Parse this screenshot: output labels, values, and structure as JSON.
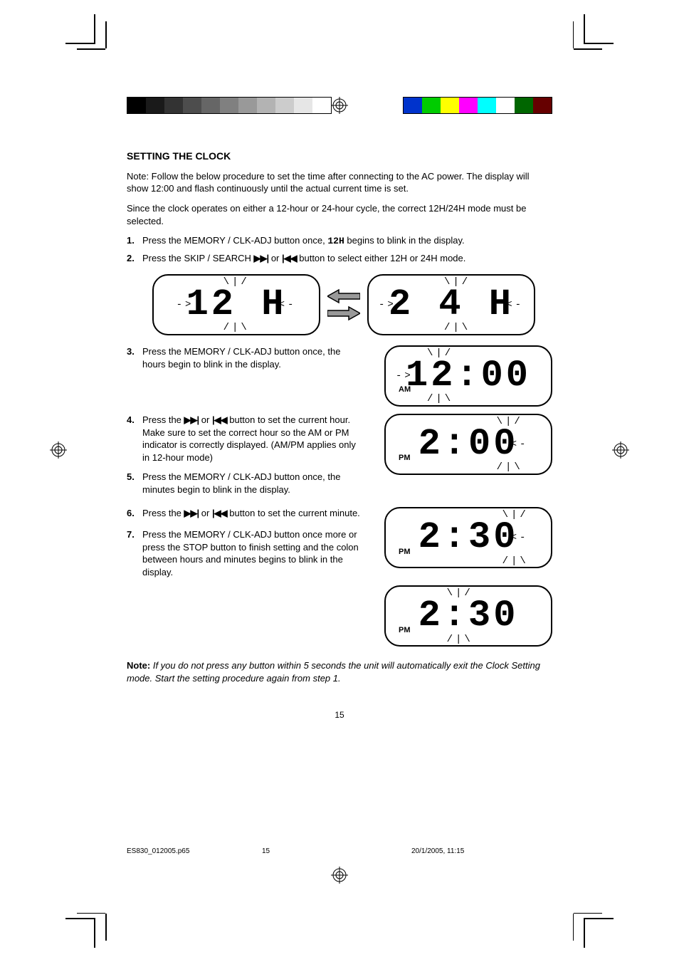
{
  "header": {
    "gray_shades": [
      "#000000",
      "#1a1a1a",
      "#333333",
      "#4d4d4d",
      "#666666",
      "#808080",
      "#999999",
      "#b3b3b3",
      "#cccccc",
      "#e6e6e6",
      "#ffffff"
    ],
    "color_swatches": [
      "#0033cc",
      "#00cc00",
      "#ffff00",
      "#ff00ff",
      "#00ffff",
      "#ffffff",
      "#006600",
      "#660000"
    ]
  },
  "section_title": "SETTING THE CLOCK",
  "intro_1": "Note: Follow the below procedure to set the time after connecting to the AC power. The display will show 12:00 and flash continuously until the actual current time is set.",
  "intro_2": "Since the clock operates on either a 12-hour or 24-hour cycle, the correct 12H/24H mode must be selected.",
  "steps": {
    "s1_a": "Press the MEMORY / CLK-ADJ button once, ",
    "s1_b": " begins to blink in the display.",
    "s1_lcd": "12H",
    "s2_a": "Press the SKIP / SEARCH ",
    "s2_b": " or ",
    "s2_c": " button to select either 12H or 24H mode.",
    "lcd_12h": "12 H",
    "lcd_24h": "2 4 H",
    "s3": "Press the MEMORY / CLK-ADJ button once, the hours begin to blink in the display.",
    "lcd_1200": "12:00",
    "lcd_1200_ampm": "AM",
    "s4_a": "Press the ",
    "s4_b": " or ",
    "s4_c": " button to set the current hour. Make sure to set the correct hour so the AM or PM indicator is correctly displayed. (AM/PM applies only in 12-hour mode)",
    "lcd_200": "2:00",
    "lcd_200_ampm": "PM",
    "s5": "Press the MEMORY / CLK-ADJ button once, the minutes begin to blink in the display.",
    "s6_a": "Press the ",
    "s6_b": " or ",
    "s6_c": " button to set the current minute.",
    "lcd_230a": "2:30",
    "lcd_230a_ampm": "PM",
    "s7": "Press the MEMORY / CLK-ADJ button once more or press the STOP button to finish setting and the colon between hours and minutes begins to blink in the display.",
    "lcd_230b": "2:30",
    "lcd_230b_ampm": "PM"
  },
  "note_label": "Note:",
  "note_text": " If you do not press any button within 5 seconds the unit will automatically exit the Clock Setting mode. Start the setting procedure again from step 1.",
  "page_number": "15",
  "footer": {
    "file": "ES830_012005.p65",
    "page": "15",
    "date": "20/1/2005, 11:15"
  },
  "glyphs": {
    "ffwd": "▶▶|",
    "rew": "|◀◀"
  }
}
